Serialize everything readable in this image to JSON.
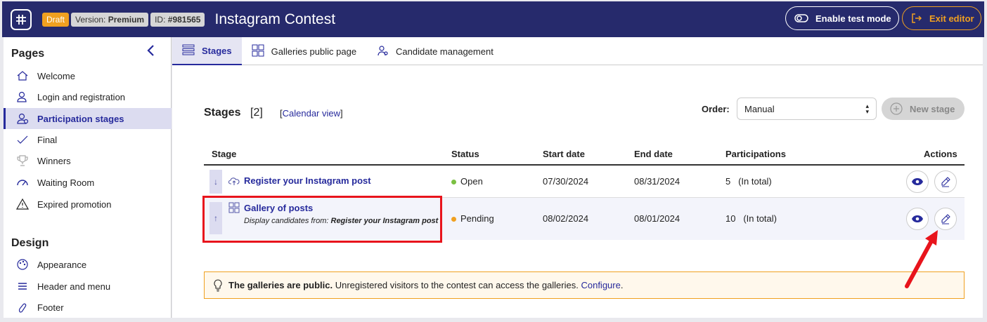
{
  "header": {
    "badge_draft": "Draft",
    "badge_version_prefix": "Version:",
    "badge_version_value": "Premium",
    "badge_id_prefix": "ID:",
    "badge_id_value": "#981565",
    "title": "Instagram Contest",
    "test_mode_label": "Enable test mode",
    "exit_label": "Exit editor"
  },
  "sidebar": {
    "pages_heading": "Pages",
    "pages_items": [
      {
        "label": "Welcome",
        "icon": "home-icon"
      },
      {
        "label": "Login and registration",
        "icon": "user-icon"
      },
      {
        "label": "Participation stages",
        "icon": "user-stage-icon",
        "active": true
      },
      {
        "label": "Final",
        "icon": "check-icon"
      },
      {
        "label": "Winners",
        "icon": "trophy-icon"
      },
      {
        "label": "Waiting Room",
        "icon": "gauge-icon"
      },
      {
        "label": "Expired promotion",
        "icon": "warning-icon"
      }
    ],
    "design_heading": "Design",
    "design_items": [
      {
        "label": "Appearance",
        "icon": "palette-icon"
      },
      {
        "label": "Header and menu",
        "icon": "menu-icon"
      },
      {
        "label": "Footer",
        "icon": "footprint-icon"
      }
    ]
  },
  "tabs": [
    {
      "label": "Stages",
      "icon": "list-icon",
      "active": true
    },
    {
      "label": "Galleries public page",
      "icon": "grid-icon"
    },
    {
      "label": "Candidate management",
      "icon": "users-icon"
    }
  ],
  "stages": {
    "title": "Stages",
    "count": "[2]",
    "calendar_bracket_open": "[",
    "calendar_link": "Calendar view",
    "calendar_bracket_close": "]",
    "order_label": "Order:",
    "order_value": "Manual",
    "new_stage_label": "New stage",
    "columns": [
      "Stage",
      "Status",
      "Start date",
      "End date",
      "Participations",
      "Actions"
    ],
    "rows": [
      {
        "arrow": "↓",
        "name": "Register your Instagram post",
        "icon": "cloud-upload-icon",
        "status": "Open",
        "status_color": "#7bc043",
        "start": "07/30/2024",
        "end": "08/31/2024",
        "participations": "5",
        "participations_note": "(In total)"
      },
      {
        "arrow": "↑",
        "name": "Gallery of posts",
        "icon": "grid-icon",
        "sub_prefix": "Display candidates from: ",
        "sub_strong": "Register your Instagram post",
        "status": "Pending",
        "status_color": "#f0a020",
        "start": "08/02/2024",
        "end": "08/01/2024",
        "participations": "10",
        "participations_note": "(In total)"
      }
    ]
  },
  "notice": {
    "strong": "The galleries are public.",
    "text": " Unregistered visitors to the contest can access the galleries. ",
    "link": "Configure",
    "period": "."
  }
}
